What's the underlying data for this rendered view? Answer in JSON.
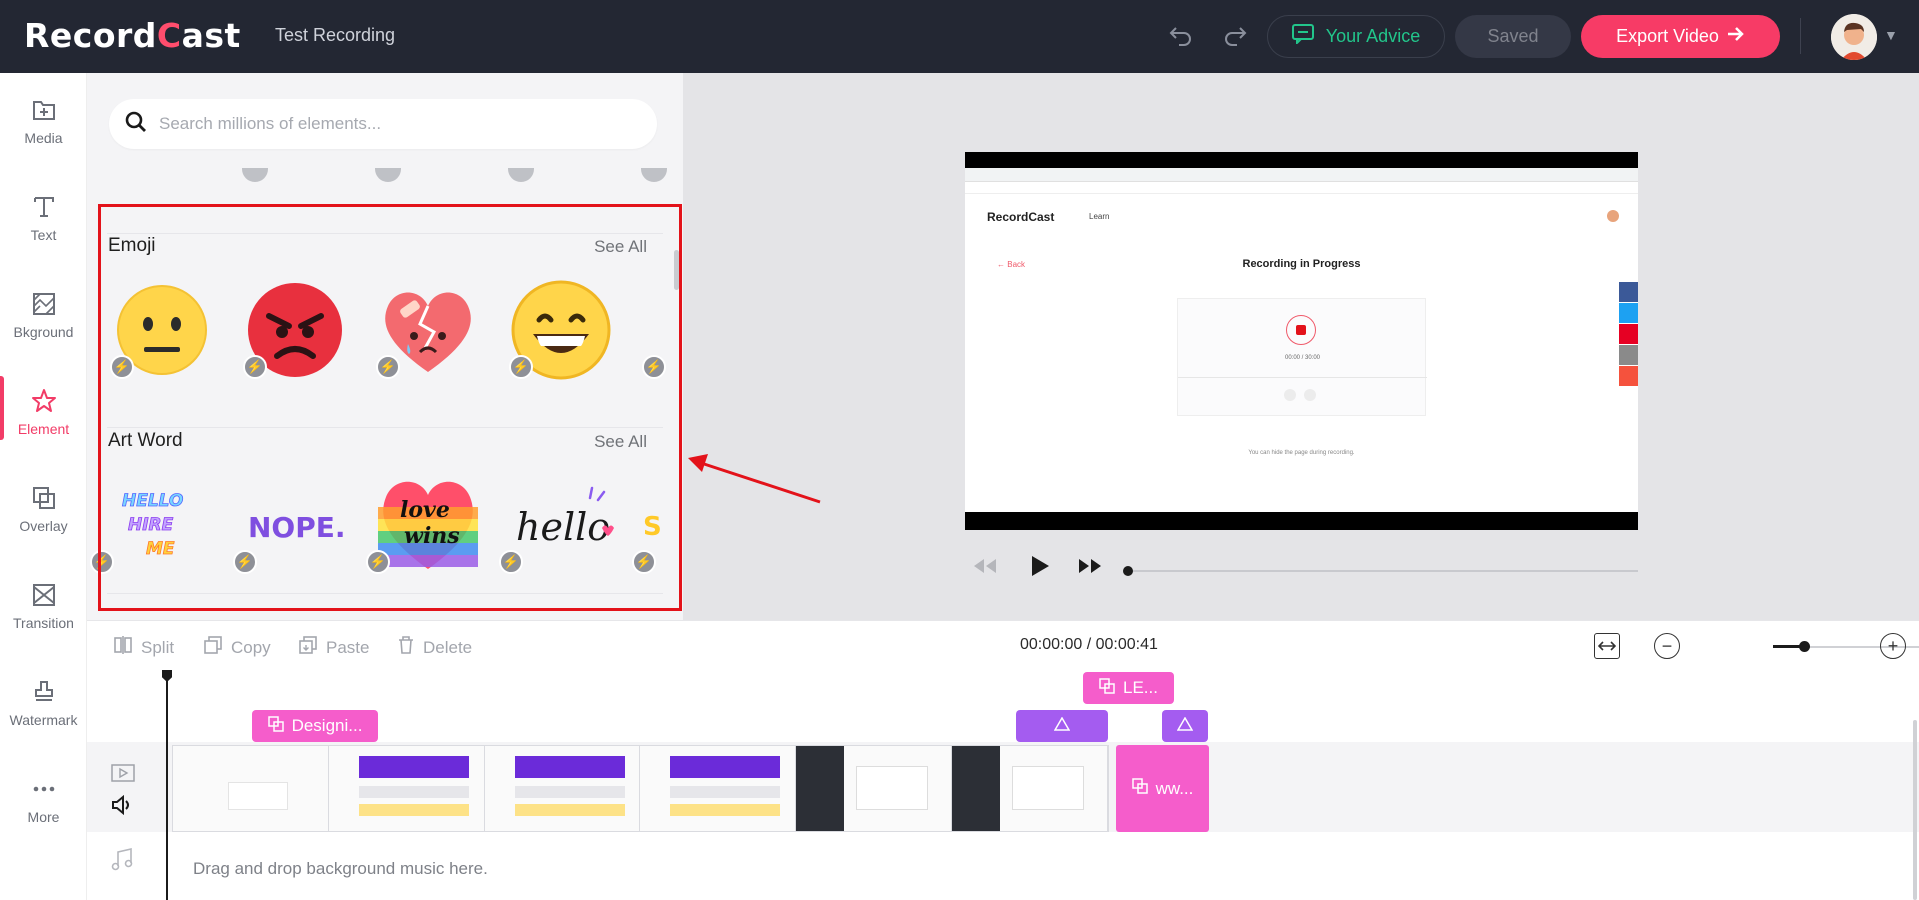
{
  "header": {
    "logo_text_a": "Record",
    "logo_text_c": "C",
    "logo_text_b": "ast",
    "project_title": "Test Recording",
    "advice_label": "Your Advice",
    "saved_label": "Saved",
    "export_label": "Export Video"
  },
  "rail": {
    "items": [
      {
        "label": "Media"
      },
      {
        "label": "Text"
      },
      {
        "label": "Bkground"
      },
      {
        "label": "Element"
      },
      {
        "label": "Overlay"
      },
      {
        "label": "Transition"
      },
      {
        "label": "Watermark"
      },
      {
        "label": "More"
      }
    ],
    "active": "Element"
  },
  "panel": {
    "search_placeholder": "Search millions of elements...",
    "sections": [
      {
        "title": "Emoji",
        "see_all": "See All"
      },
      {
        "title": "Art Word",
        "see_all": "See All"
      }
    ],
    "art_words": [
      "HELLO HIRE ME",
      "NOPE.",
      "love wins",
      "hello"
    ]
  },
  "preview": {
    "screen_logo": "RecordCast",
    "screen_nav": "Learn",
    "screen_back": "Back",
    "screen_title": "Recording in Progress",
    "screen_timer": "00:00 / 30:00",
    "screen_hint": "You can hide the page during recording."
  },
  "toolbar": {
    "split": "Split",
    "copy": "Copy",
    "paste": "Paste",
    "delete": "Delete",
    "timecode": "00:00:00 / 00:00:41"
  },
  "timeline": {
    "chip_design": "Designi...",
    "chip_le": "LE...",
    "block_ww": "ww...",
    "music_placeholder": "Drag and drop background music here."
  },
  "colors": {
    "accent": "#f23c67",
    "header_bg": "#232733",
    "advice_green": "#22c58b",
    "chip_pink": "#f55dcb",
    "chip_purple": "#a45cf0",
    "highlight_red": "#e3121a"
  }
}
